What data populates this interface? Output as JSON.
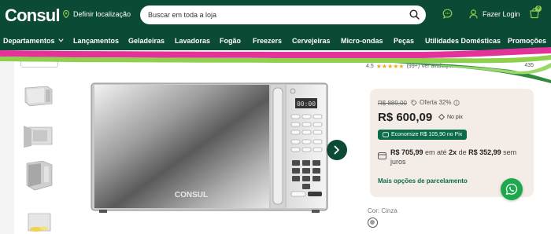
{
  "header": {
    "logo": "Consul",
    "location_label": "Definir localização",
    "search_placeholder": "Buscar em toda a loja",
    "login_label": "Fazer Login",
    "cart_count": "0"
  },
  "nav": {
    "items": [
      {
        "label": "Departamentos",
        "has_dropdown": true
      },
      {
        "label": "Lançamentos"
      },
      {
        "label": "Geladeiras"
      },
      {
        "label": "Lavadoras"
      },
      {
        "label": "Fogão"
      },
      {
        "label": "Freezers"
      },
      {
        "label": "Cervejeiras"
      },
      {
        "label": "Micro-ondas"
      },
      {
        "label": "Peças"
      },
      {
        "label": "Utilidades Domésticas"
      },
      {
        "label": "Promoções"
      }
    ]
  },
  "product": {
    "rating_value": "4.5",
    "reviews_partial": "(99+) Ver avaliaç...",
    "reviews_count": "435",
    "old_price": "R$ 889,00",
    "offer_label": "Oferta 32%",
    "price": "R$ 600,09",
    "pix_label": "No pix",
    "economy_label": "Economize R$ 105,90 no Pix",
    "installment": {
      "total": "R$ 705,99",
      "text_1": " em até ",
      "times": "2x",
      "text_2": " de ",
      "each": "R$ 352,99",
      "text_3": " sem juros"
    },
    "more_installments": "Mais opções de parcelamento",
    "color_label": "Cor: Cinza",
    "brand_on_image": "CONSUL",
    "display_time": "00:00"
  },
  "colors": {
    "brand_green": "#0b4a35",
    "accent_green": "#8fd14f",
    "pink_stripe": "#e3339b",
    "price_card_bg": "#f4ede7",
    "whatsapp_green": "#1ea84d",
    "star": "#f2a81d"
  },
  "icons": [
    "map-pin-icon",
    "search-icon",
    "chat-icon",
    "user-icon",
    "cart-icon",
    "chevron-down-icon",
    "chevron-right-icon",
    "pix-icon",
    "info-icon",
    "card-icon",
    "whatsapp-icon"
  ]
}
